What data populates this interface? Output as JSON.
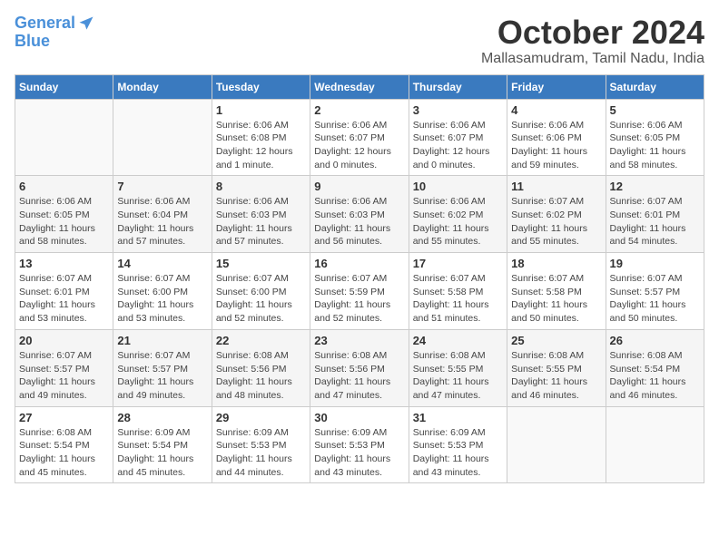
{
  "logo": {
    "line1": "General",
    "line2": "Blue"
  },
  "title": "October 2024",
  "location": "Mallasamudram, Tamil Nadu, India",
  "weekdays": [
    "Sunday",
    "Monday",
    "Tuesday",
    "Wednesday",
    "Thursday",
    "Friday",
    "Saturday"
  ],
  "weeks": [
    [
      {
        "day": "",
        "info": ""
      },
      {
        "day": "",
        "info": ""
      },
      {
        "day": "1",
        "info": "Sunrise: 6:06 AM\nSunset: 6:08 PM\nDaylight: 12 hours\nand 1 minute."
      },
      {
        "day": "2",
        "info": "Sunrise: 6:06 AM\nSunset: 6:07 PM\nDaylight: 12 hours\nand 0 minutes."
      },
      {
        "day": "3",
        "info": "Sunrise: 6:06 AM\nSunset: 6:07 PM\nDaylight: 12 hours\nand 0 minutes."
      },
      {
        "day": "4",
        "info": "Sunrise: 6:06 AM\nSunset: 6:06 PM\nDaylight: 11 hours\nand 59 minutes."
      },
      {
        "day": "5",
        "info": "Sunrise: 6:06 AM\nSunset: 6:05 PM\nDaylight: 11 hours\nand 58 minutes."
      }
    ],
    [
      {
        "day": "6",
        "info": "Sunrise: 6:06 AM\nSunset: 6:05 PM\nDaylight: 11 hours\nand 58 minutes."
      },
      {
        "day": "7",
        "info": "Sunrise: 6:06 AM\nSunset: 6:04 PM\nDaylight: 11 hours\nand 57 minutes."
      },
      {
        "day": "8",
        "info": "Sunrise: 6:06 AM\nSunset: 6:03 PM\nDaylight: 11 hours\nand 57 minutes."
      },
      {
        "day": "9",
        "info": "Sunrise: 6:06 AM\nSunset: 6:03 PM\nDaylight: 11 hours\nand 56 minutes."
      },
      {
        "day": "10",
        "info": "Sunrise: 6:06 AM\nSunset: 6:02 PM\nDaylight: 11 hours\nand 55 minutes."
      },
      {
        "day": "11",
        "info": "Sunrise: 6:07 AM\nSunset: 6:02 PM\nDaylight: 11 hours\nand 55 minutes."
      },
      {
        "day": "12",
        "info": "Sunrise: 6:07 AM\nSunset: 6:01 PM\nDaylight: 11 hours\nand 54 minutes."
      }
    ],
    [
      {
        "day": "13",
        "info": "Sunrise: 6:07 AM\nSunset: 6:01 PM\nDaylight: 11 hours\nand 53 minutes."
      },
      {
        "day": "14",
        "info": "Sunrise: 6:07 AM\nSunset: 6:00 PM\nDaylight: 11 hours\nand 53 minutes."
      },
      {
        "day": "15",
        "info": "Sunrise: 6:07 AM\nSunset: 6:00 PM\nDaylight: 11 hours\nand 52 minutes."
      },
      {
        "day": "16",
        "info": "Sunrise: 6:07 AM\nSunset: 5:59 PM\nDaylight: 11 hours\nand 52 minutes."
      },
      {
        "day": "17",
        "info": "Sunrise: 6:07 AM\nSunset: 5:58 PM\nDaylight: 11 hours\nand 51 minutes."
      },
      {
        "day": "18",
        "info": "Sunrise: 6:07 AM\nSunset: 5:58 PM\nDaylight: 11 hours\nand 50 minutes."
      },
      {
        "day": "19",
        "info": "Sunrise: 6:07 AM\nSunset: 5:57 PM\nDaylight: 11 hours\nand 50 minutes."
      }
    ],
    [
      {
        "day": "20",
        "info": "Sunrise: 6:07 AM\nSunset: 5:57 PM\nDaylight: 11 hours\nand 49 minutes."
      },
      {
        "day": "21",
        "info": "Sunrise: 6:07 AM\nSunset: 5:57 PM\nDaylight: 11 hours\nand 49 minutes."
      },
      {
        "day": "22",
        "info": "Sunrise: 6:08 AM\nSunset: 5:56 PM\nDaylight: 11 hours\nand 48 minutes."
      },
      {
        "day": "23",
        "info": "Sunrise: 6:08 AM\nSunset: 5:56 PM\nDaylight: 11 hours\nand 47 minutes."
      },
      {
        "day": "24",
        "info": "Sunrise: 6:08 AM\nSunset: 5:55 PM\nDaylight: 11 hours\nand 47 minutes."
      },
      {
        "day": "25",
        "info": "Sunrise: 6:08 AM\nSunset: 5:55 PM\nDaylight: 11 hours\nand 46 minutes."
      },
      {
        "day": "26",
        "info": "Sunrise: 6:08 AM\nSunset: 5:54 PM\nDaylight: 11 hours\nand 46 minutes."
      }
    ],
    [
      {
        "day": "27",
        "info": "Sunrise: 6:08 AM\nSunset: 5:54 PM\nDaylight: 11 hours\nand 45 minutes."
      },
      {
        "day": "28",
        "info": "Sunrise: 6:09 AM\nSunset: 5:54 PM\nDaylight: 11 hours\nand 45 minutes."
      },
      {
        "day": "29",
        "info": "Sunrise: 6:09 AM\nSunset: 5:53 PM\nDaylight: 11 hours\nand 44 minutes."
      },
      {
        "day": "30",
        "info": "Sunrise: 6:09 AM\nSunset: 5:53 PM\nDaylight: 11 hours\nand 43 minutes."
      },
      {
        "day": "31",
        "info": "Sunrise: 6:09 AM\nSunset: 5:53 PM\nDaylight: 11 hours\nand 43 minutes."
      },
      {
        "day": "",
        "info": ""
      },
      {
        "day": "",
        "info": ""
      }
    ]
  ]
}
